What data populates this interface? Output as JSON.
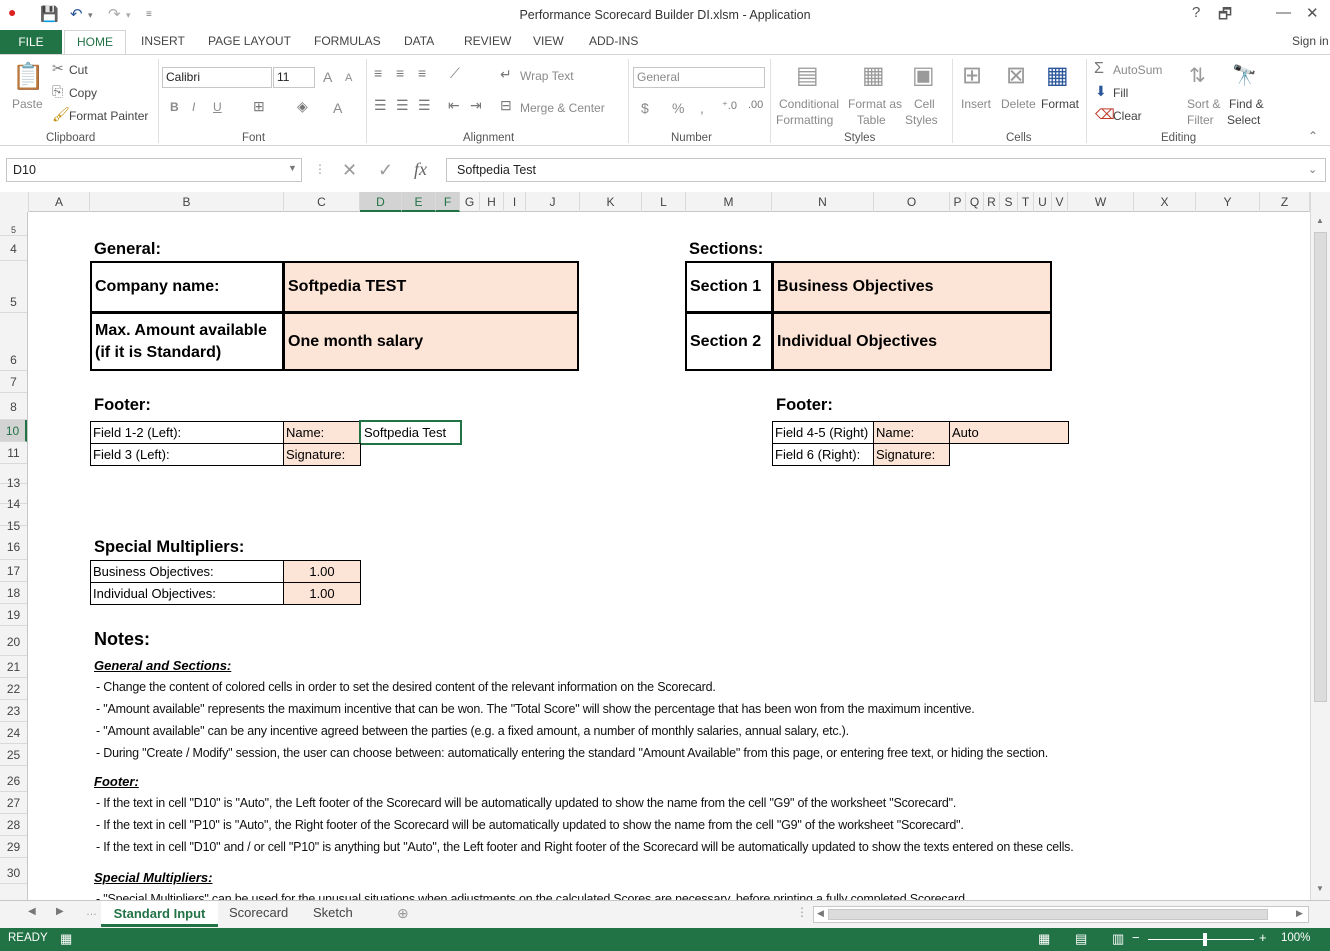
{
  "window": {
    "title": "Performance Scorecard Builder DI.xlsm - Application",
    "help": "?",
    "restore": "🗗",
    "minimize": "—",
    "close": "✕"
  },
  "tabs": {
    "file": "FILE",
    "home": "HOME",
    "insert": "INSERT",
    "page_layout": "PAGE LAYOUT",
    "formulas": "FORMULAS",
    "data": "DATA",
    "review": "REVIEW",
    "view": "VIEW",
    "addins": "ADD-INS",
    "signin": "Sign in"
  },
  "ribbon": {
    "clipboard": {
      "paste": "Paste",
      "cut": "Cut",
      "copy": "Copy",
      "format_painter": "Format Painter",
      "label": "Clipboard"
    },
    "font": {
      "name": "Calibri",
      "size": "11",
      "bold": "B",
      "italic": "I",
      "underline": "U",
      "grow": "A",
      "shrink": "A",
      "color": "A",
      "label": "Font"
    },
    "alignment": {
      "wrap_text": "Wrap Text",
      "merge_center": "Merge & Center",
      "label": "Alignment"
    },
    "number": {
      "format": "General",
      "currency": "$",
      "percent": "%",
      "comma": ",",
      "label": "Number"
    },
    "styles": {
      "conditional_1": "Conditional",
      "conditional_2": "Formatting",
      "format_as_1": "Format as",
      "format_as_2": "Table",
      "cell_1": "Cell",
      "cell_2": "Styles",
      "label": "Styles"
    },
    "cells": {
      "insert": "Insert",
      "delete": "Delete",
      "format": "Format",
      "label": "Cells"
    },
    "editing": {
      "autosum": "AutoSum",
      "fill": "Fill",
      "clear": "Clear",
      "sort_1": "Sort &",
      "sort_2": "Filter",
      "find_1": "Find &",
      "find_2": "Select",
      "label": "Editing"
    }
  },
  "formula_bar": {
    "name_box": "D10",
    "fx": "fx",
    "content": "Softpedia Test"
  },
  "columns": [
    "A",
    "B",
    "C",
    "D",
    "E",
    "F",
    "G",
    "H",
    "I",
    "J",
    "K",
    "L",
    "M",
    "N",
    "O",
    "P",
    "Q",
    "R",
    "S",
    "T",
    "U",
    "V",
    "W",
    "X",
    "Y",
    "Z"
  ],
  "rows": [
    "5",
    "4",
    "5",
    "6",
    "7",
    "8",
    "10",
    "11",
    "13",
    "14",
    "15",
    "16",
    "17",
    "18",
    "19",
    "20",
    "21",
    "22",
    "23",
    "24",
    "25",
    "26",
    "27",
    "28",
    "29",
    "30"
  ],
  "sheet": {
    "general_header": "General:",
    "sections_header": "Sections:",
    "company_label": "Company name:",
    "company_value": "Softpedia TEST",
    "max_amount_label_1": "Max. Amount available",
    "max_amount_label_2": "(if it is Standard)",
    "max_amount_value": "One month salary",
    "section1_label": "Section 1",
    "section1_value": "Business Objectives",
    "section2_label": "Section 2",
    "section2_value": "Individual Objectives",
    "footer_left_header": "Footer:",
    "footer_right_header": "Footer:",
    "field12": "Field 1-2 (Left):",
    "field3": "Field 3 (Left):",
    "name_label_left": "Name:",
    "signature_label_left": "Signature:",
    "name_value_left": "Softpedia Test",
    "field45": "Field 4-5 (Right)",
    "field6": "Field 6 (Right):",
    "name_label_right": "Name:",
    "signature_label_right": "Signature:",
    "name_value_right": "Auto",
    "multipliers_header": "Special Multipliers:",
    "mult_business_label": "Business Objectives:",
    "mult_business_value": "1.00",
    "mult_individual_label": "Individual Objectives:",
    "mult_individual_value": "1.00",
    "notes_header": "Notes:",
    "notes_general_h": "General and Sections:",
    "note1": " - Change the content of colored cells in order to set the desired content of the relevant information on the Scorecard.",
    "note2": " - \"Amount available\" represents the maximum incentive that can be won. The \"Total Score\" will show the percentage that has been won from the maximum incentive.",
    "note3": " - \"Amount available\" can be any incentive agreed between the parties (e.g. a fixed amount, a number of monthly salaries, annual salary, etc.).",
    "note4": " - During \"Create / Modify\" session, the user can choose between: automatically entering the standard \"Amount Available\" from this page, or entering free text, or hiding the section.",
    "notes_footer_h": "Footer:",
    "note5": " - If the text in cell \"D10\" is \"Auto\",  the Left footer of the Scorecard will be automatically updated to show the name from the cell \"G9\" of the worksheet \"Scorecard\".",
    "note6": " - If the text in cell \"P10\" is \"Auto\",  the Right footer of the Scorecard will be automatically updated to show the name from the cell \"G9\" of the worksheet \"Scorecard\".",
    "note7": " - If the text in cell \"D10\" and / or cell \"P10\" is anything but \"Auto\",  the Left footer and Right footer of the Scorecard will be automatically updated to show the texts entered on these cells.",
    "notes_mult_h": "Special Multipliers:",
    "note8": " - \"Special Multipliers\" can be used for the unusual situations when adjustments on the calculated Scores are necessary, before printing a fully completed Scorecard."
  },
  "sheet_tabs": {
    "active": "Standard Input",
    "scorecard": "Scorecard",
    "sketch": "Sketch"
  },
  "status": {
    "ready": "READY",
    "zoom": "100%"
  },
  "colors": {
    "excel_green": "#217346",
    "fill": "#fce4d6"
  }
}
